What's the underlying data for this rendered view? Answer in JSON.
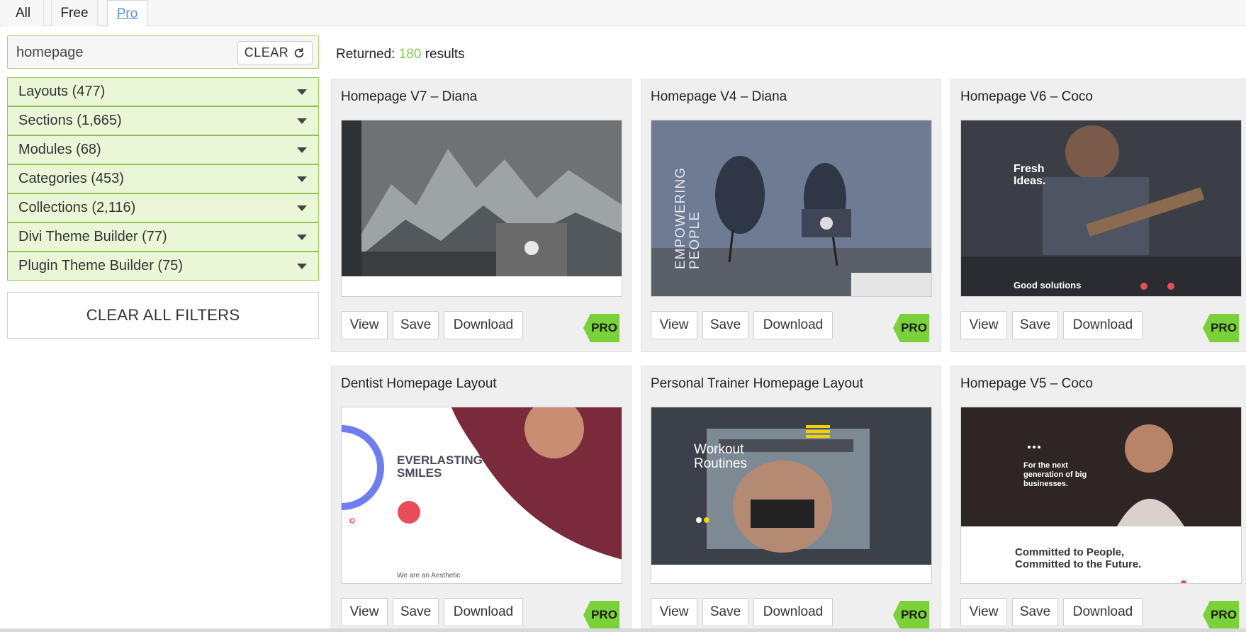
{
  "tabs": [
    {
      "label": "All"
    },
    {
      "label": "Free"
    },
    {
      "label": "Pro"
    }
  ],
  "search": {
    "value": "homepage",
    "clear_label": "CLEAR"
  },
  "filters": [
    {
      "label": "Layouts (477)"
    },
    {
      "label": "Sections (1,665)"
    },
    {
      "label": "Modules (68)"
    },
    {
      "label": "Categories (453)"
    },
    {
      "label": "Collections (2,116)"
    },
    {
      "label": "Divi Theme Builder (77)"
    },
    {
      "label": "Plugin Theme Builder (75)"
    }
  ],
  "clear_all_label": "CLEAR ALL FILTERS",
  "results": {
    "prefix": "Returned:",
    "count": "180",
    "suffix": "results"
  },
  "actions": {
    "view": "View",
    "save": "Save",
    "download": "Download",
    "badge": "PRO"
  },
  "cards": [
    {
      "title": "Homepage V7 – Diana"
    },
    {
      "title": "Homepage V4 – Diana",
      "thumb_text": "EMPOWERING PEOPLE"
    },
    {
      "title": "Homepage V6 – Coco",
      "thumb_text": "Fresh Ideas.",
      "thumb_sub": "Good solutions"
    },
    {
      "title": "Dentist Homepage Layout",
      "thumb_text": "EVERLASTING SMILES",
      "thumb_sub": "We are an Aesthetic"
    },
    {
      "title": "Personal Trainer Homepage Layout",
      "thumb_text": "Workout Routines"
    },
    {
      "title": "Homepage V5 – Coco",
      "thumb_text": "For the next generation of big businesses.",
      "thumb_sub": "Committed to People, Committed to the Future."
    }
  ],
  "colors": {
    "accent_green": "#7bd13a",
    "filter_bg": "#eaf7d7",
    "filter_border": "#97c65a",
    "count_green": "#82c84a",
    "link_blue": "#5b8fd9"
  }
}
